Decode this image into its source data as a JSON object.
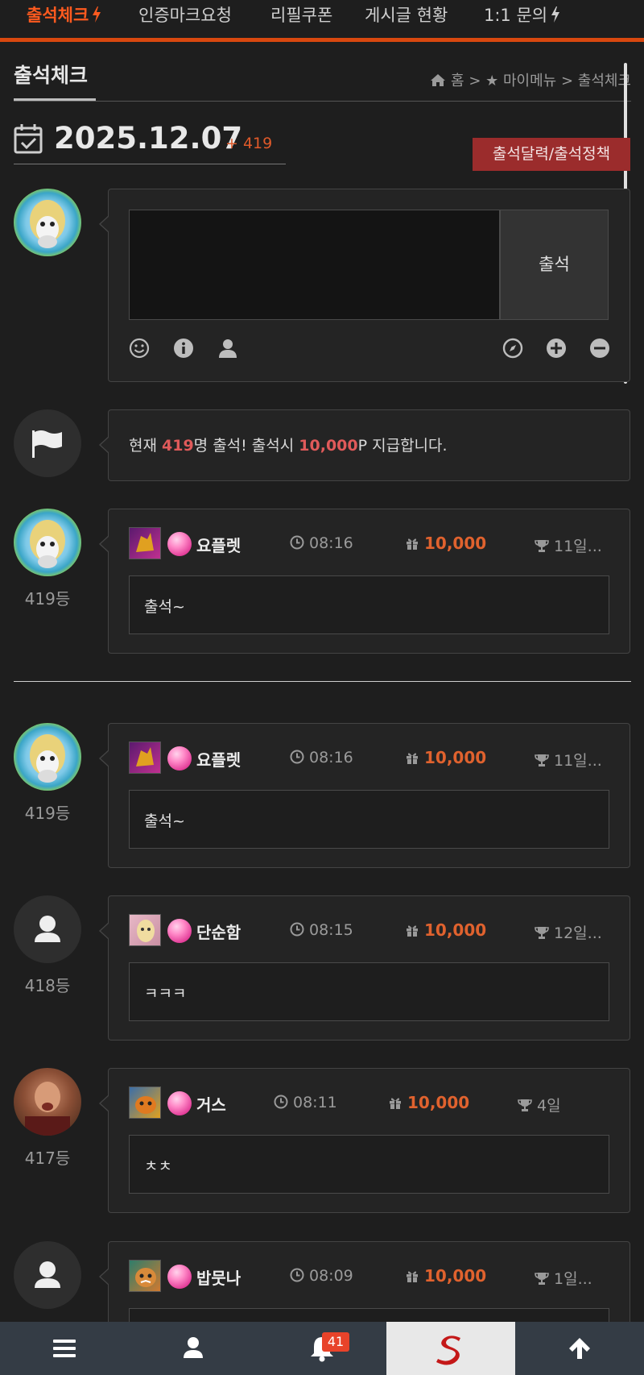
{
  "topnav": {
    "tabs": [
      {
        "label": "출석체크",
        "active": true
      },
      {
        "label": "인증마크요청"
      },
      {
        "label": "리필쿠폰"
      },
      {
        "label": "게시글 현황"
      },
      {
        "label": "1:1 문의"
      }
    ],
    "accent": "#d9480f"
  },
  "page": {
    "title": "출석체크",
    "breadcrumb": "홈 > ★ 마이메뉴 > 출석체크"
  },
  "date_row": {
    "date": "2025.12.07",
    "plus": "+ 419",
    "policy_button": "출석달력/출석정책"
  },
  "composer": {
    "submit_label": "출석",
    "tools_left": [
      "smile-icon",
      "info-icon",
      "user-icon"
    ],
    "tools_right": [
      "compass-icon",
      "plus-circle-icon",
      "minus-circle-icon"
    ]
  },
  "notice": {
    "prefix": "현재 ",
    "count": "419",
    "mid": "명 출석! 출석시 ",
    "points": "10,000",
    "suffix": "P 지급합니다."
  },
  "entries": [
    {
      "rank": "419등",
      "nick": "요플렛",
      "time": "08:16",
      "points": "10,000",
      "streak": "11일...",
      "message": "출석~"
    },
    {
      "rank": "419등",
      "nick": "요플렛",
      "time": "08:16",
      "points": "10,000",
      "streak": "11일...",
      "message": "출석~"
    },
    {
      "rank": "418등",
      "nick": "단순함",
      "time": "08:15",
      "points": "10,000",
      "streak": "12일...",
      "message": "ㅋㅋㅋ"
    },
    {
      "rank": "417등",
      "nick": "거스",
      "time": "08:11",
      "points": "10,000",
      "streak": "4일",
      "message": "ㅊㅊ"
    },
    {
      "rank": "",
      "nick": "밥뭇나",
      "time": "08:09",
      "points": "10,000",
      "streak": "1일...",
      "message": ""
    }
  ],
  "bottomnav": {
    "items": [
      "menu-icon",
      "user-icon",
      "bell-icon",
      "site-logo",
      "arrow-up-icon"
    ],
    "notification_count": "41"
  }
}
